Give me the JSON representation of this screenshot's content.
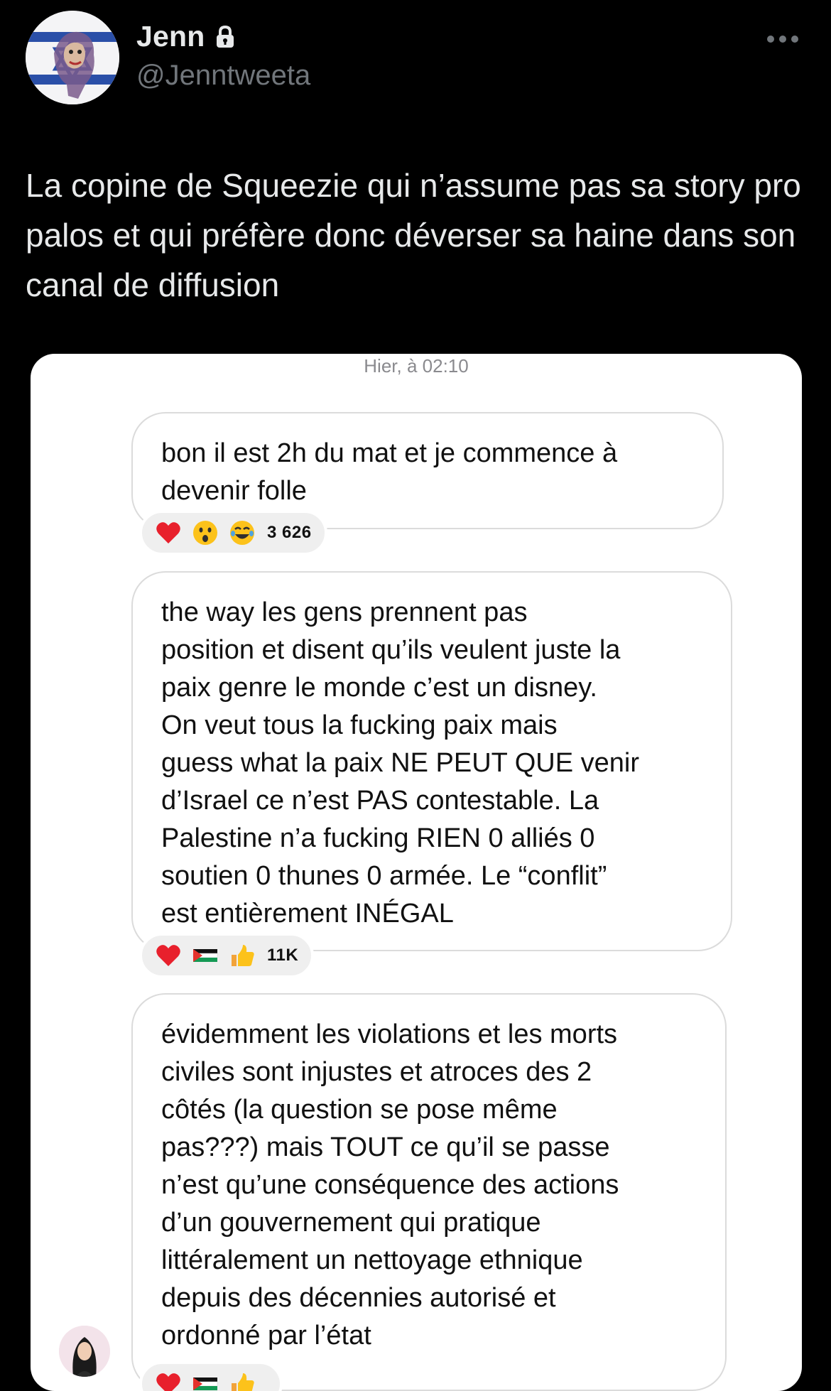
{
  "header": {
    "display_name": "Jenn",
    "handle": "@Jenntweeta",
    "icons": {
      "lock": "lock-icon",
      "more": "more-options-icon",
      "avatar": "profile-avatar"
    }
  },
  "tweet": {
    "text": "La copine de Squeezie qui n’assume pas sa story pro palos et qui préfère donc déverser sa haine dans son canal de diffusion"
  },
  "screenshot": {
    "timestamp": "Hier, à 02:10",
    "messages": [
      {
        "text": "bon il est 2h du mat et je commence à\ndevenir folle",
        "reactions": [
          "heart-emoji",
          "surprised-emoji",
          "laughing-emoji"
        ],
        "reaction_count": "3 626"
      },
      {
        "text": "the way les gens prennent pas\nposition et disent qu’ils veulent juste la\npaix genre le monde c’est un disney.\nOn veut tous la fucking paix mais\nguess what la paix NE PEUT QUE venir\nd’Israel ce n’est PAS contestable. La\nPalestine n’a fucking RIEN 0 alliés 0\nsoutien 0 thunes 0 armée. Le “conflit”\nest entièrement INÉGAL",
        "reactions": [
          "heart-emoji",
          "palestine-flag-emoji",
          "thumbs-up-emoji"
        ],
        "reaction_count": "11K"
      },
      {
        "text": "évidemment les violations et les morts\nciviles sont injustes et atroces des 2\ncôtés (la question se pose même\npas???) mais TOUT ce qu’il se passe\nn’est qu’une conséquence des actions\nd’un gouvernement qui pratique\nlittéralement un nettoyage ethnique\ndepuis des décennies autorisé et\nordonné par l’état",
        "reactions": [
          "heart-emoji",
          "palestine-flag-emoji",
          "thumbs-up-emoji"
        ],
        "reaction_count": ""
      }
    ]
  },
  "colors": {
    "background": "#000000",
    "primary_text": "#e7e9ea",
    "secondary_text": "#71767b",
    "card_background": "#ffffff",
    "bubble_border": "#dbdbdb",
    "reaction_pill": "#efefef"
  }
}
